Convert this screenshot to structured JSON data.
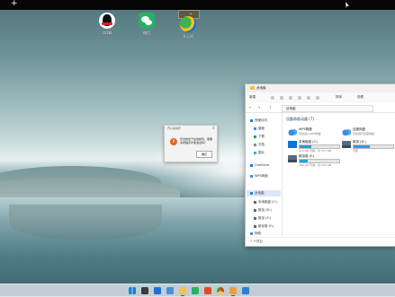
{
  "desktop": {
    "icons": [
      {
        "label": "QQ聊",
        "icon": "qq-penguin-icon"
      },
      {
        "label": "微信",
        "icon": "wechat-icon"
      },
      {
        "label": "开心消",
        "icon": "game-icon"
      }
    ]
  },
  "topbar": {
    "new_tab_glyph": "+"
  },
  "dialog": {
    "title": "开心消消乐",
    "message": "您当前处于在线模式，需要关闭程序才能退出吗？",
    "ok_label": "确定",
    "close_glyph": "×"
  },
  "explorer": {
    "title": "此电脑",
    "toolbar": {
      "new_label": "新建",
      "sort_label": "排序",
      "view_label": "查看"
    },
    "nav_back": "←",
    "nav_forward": "→",
    "nav_up": "↑",
    "address": "此电脑",
    "section_header": "设备和驱动器 (7)",
    "nav_items": [
      {
        "label": "快速访问"
      },
      {
        "label": "桌面"
      },
      {
        "label": "下载"
      },
      {
        "label": "文档"
      },
      {
        "label": "图片"
      },
      {
        "label": "OneDrive"
      },
      {
        "label": "WPS网盘"
      },
      {
        "label": "此电脑"
      },
      {
        "label": "本地磁盘 (C:)"
      },
      {
        "label": "新加 (D:)"
      },
      {
        "label": "新加 (E:)"
      },
      {
        "label": "新加卷 (F:)"
      },
      {
        "label": "网络"
      }
    ],
    "drives": [
      {
        "name": "WPS网盘",
        "sub": "双击进入WPS网盘"
      },
      {
        "name": "百度网盘",
        "sub": "双击运行百度网盘"
      },
      {
        "name": "本地磁盘 (C:)",
        "free": "213 GB 可用，共 237 GB",
        "used_fraction": 0.3
      },
      {
        "name": "新加 (D:)",
        "free": "可用",
        "used_fraction": 0.4
      },
      {
        "name": "新加卷 (F:)",
        "free": "169 GB 可用，共 200 GB",
        "used_fraction": 0.2
      }
    ],
    "status": "7 个项目"
  },
  "colors": {
    "accent": "#0a74da",
    "dialog_icon": "#e2661f",
    "folder": "#f2c14e"
  }
}
